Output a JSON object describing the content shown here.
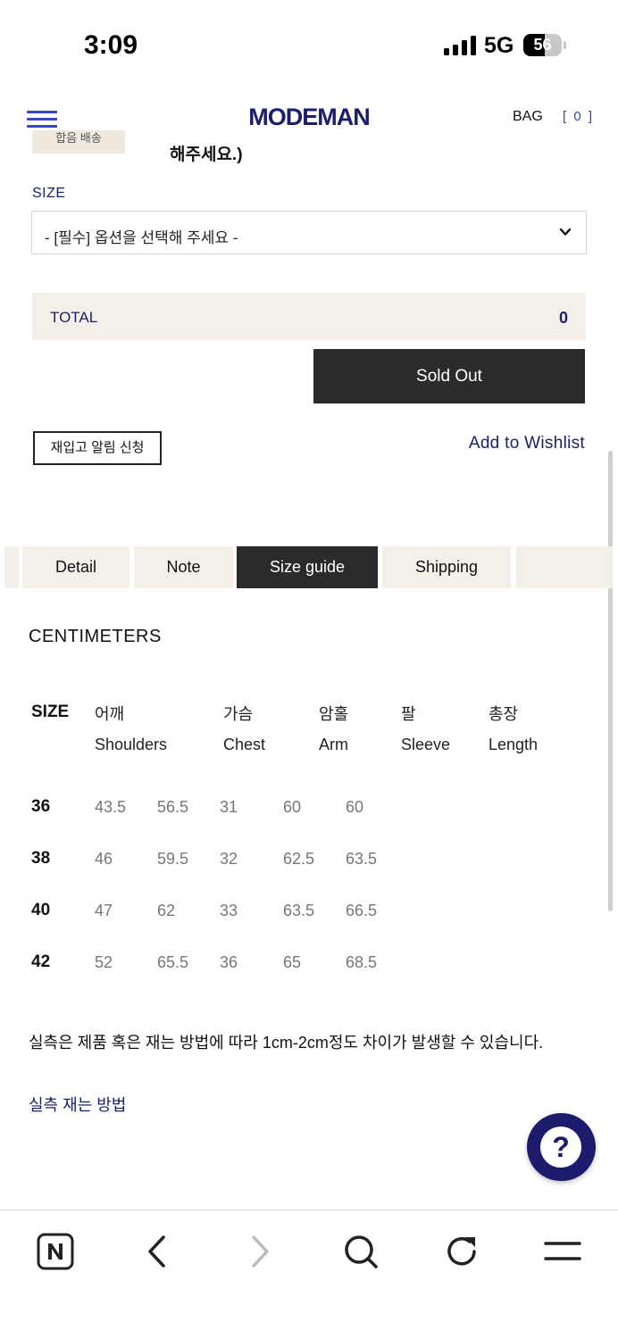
{
  "status_bar": {
    "time": "3:09",
    "network": "5G",
    "battery": "56",
    "battery_level": 0.56
  },
  "header": {
    "logo": "MODEMAN",
    "bag_label": "BAG",
    "bag_count": "[ 0 ]"
  },
  "previous_option": {
    "chip_text": "합음 배송",
    "text": "해주세요.)"
  },
  "size_option": {
    "label": "SIZE",
    "selected": "- [필수] 옵션을 선택해 주세요 -"
  },
  "total": {
    "label": "TOTAL",
    "value": "0"
  },
  "buttons": {
    "sold_out": "Sold Out",
    "restock": "재입고 알림 신청",
    "wishlist": "Add to Wishlist"
  },
  "tabs": [
    {
      "label": "Detail",
      "active": false
    },
    {
      "label": "Note",
      "active": false
    },
    {
      "label": "Size guide",
      "active": true
    },
    {
      "label": "Shipping",
      "active": false
    }
  ],
  "size_guide": {
    "unit_title": "CENTIMETERS",
    "size_header": "SIZE",
    "columns": [
      {
        "kr": "어깨",
        "en": "Shoulders"
      },
      {
        "kr": "가슴",
        "en": "Chest"
      },
      {
        "kr": "암홀",
        "en": "Arm"
      },
      {
        "kr": "팔",
        "en": "Sleeve"
      },
      {
        "kr": "총장",
        "en": "Length"
      }
    ],
    "rows": [
      {
        "size": "36",
        "values": [
          "43.5",
          "56.5",
          "31",
          "60",
          "60"
        ]
      },
      {
        "size": "38",
        "values": [
          "46",
          "59.5",
          "32",
          "62.5",
          "63.5"
        ]
      },
      {
        "size": "40",
        "values": [
          "47",
          "62",
          "33",
          "63.5",
          "66.5"
        ]
      },
      {
        "size": "42",
        "values": [
          "52",
          "65.5",
          "36",
          "65",
          "68.5"
        ]
      }
    ],
    "note": "실측은 제품 혹은 재는 방법에 따라 1cm-2cm정도 차이가 발생할 수 있습니다.",
    "measure_link": "실측 재는 방법"
  },
  "help_button": {
    "symbol": "?"
  },
  "toolbar": {
    "icons": [
      "naver-icon",
      "back-icon",
      "forward-icon",
      "search-icon",
      "reload-icon",
      "menu-icon"
    ]
  },
  "colors": {
    "brand": "#1b1f6b",
    "accent": "#3445c4",
    "beige": "#f4efe9",
    "dark": "#2b2b2b"
  }
}
